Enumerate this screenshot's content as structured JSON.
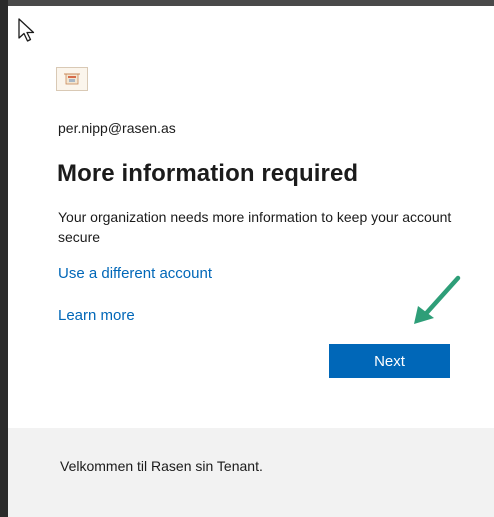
{
  "account": {
    "email": "per.nipp@rasen.as"
  },
  "main": {
    "title": "More information required",
    "description": "Your organization needs more information to keep your account secure",
    "use_different_account_label": "Use a different account",
    "learn_more_label": "Learn more",
    "next_label": "Next"
  },
  "footer": {
    "text": "Velkommen til Rasen sin Tenant."
  },
  "icons": {
    "cursor": "mouse-pointer-icon",
    "logo": "company-logo-icon",
    "annotation": "green-arrow-icon"
  },
  "colors": {
    "accent": "#0067b8",
    "arrow": "#2e9e78",
    "footer_bg": "#f2f2f2"
  }
}
